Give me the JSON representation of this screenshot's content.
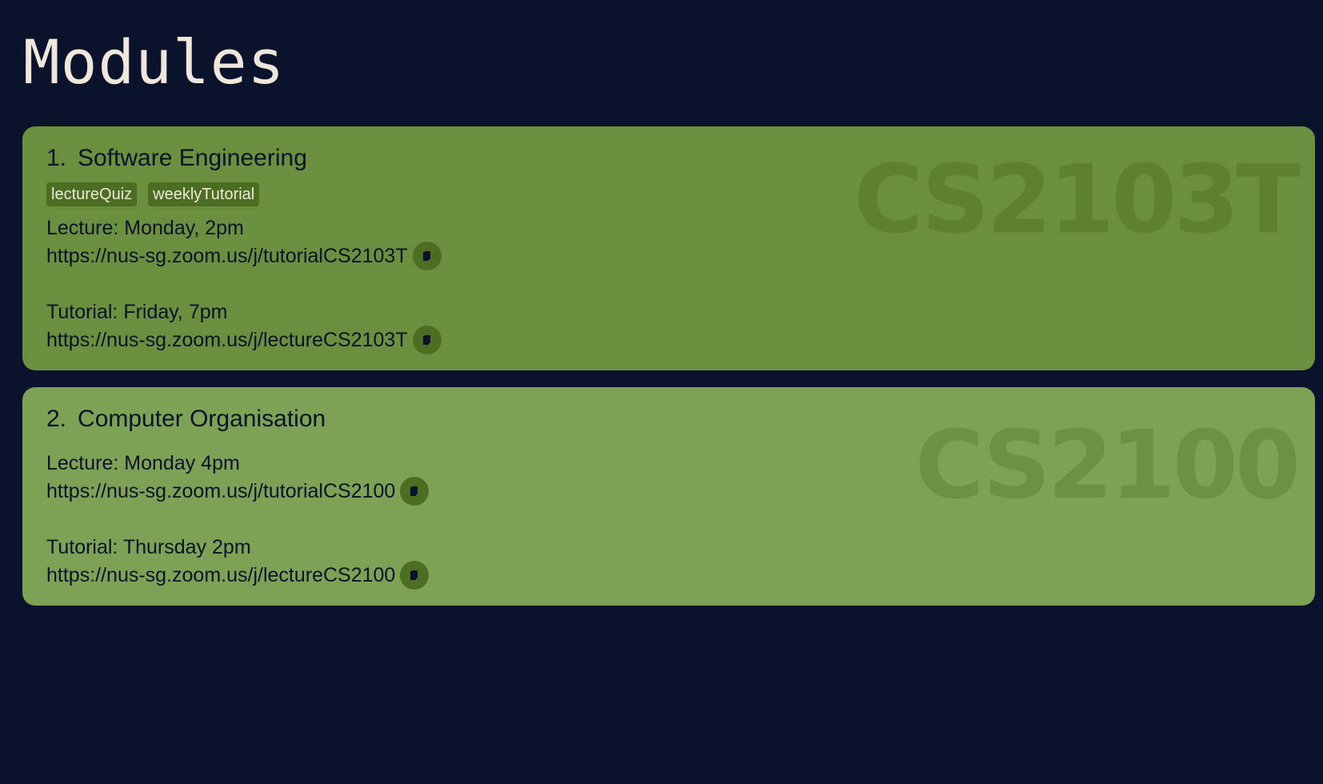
{
  "page": {
    "title": "Modules"
  },
  "modules": [
    {
      "index": "1.",
      "name": "Software Engineering",
      "code": "CS2103T",
      "tags": [
        "lectureQuiz",
        "weeklyTutorial"
      ],
      "lecture_label": "Lecture: Monday, 2pm",
      "lecture_link": "https://nus-sg.zoom.us/j/tutorialCS2103T",
      "tutorial_label": "Tutorial: Friday, 7pm",
      "tutorial_link": "https://nus-sg.zoom.us/j/lectureCS2103T",
      "color": "#6a8f3f"
    },
    {
      "index": "2.",
      "name": "Computer Organisation",
      "code": "CS2100",
      "tags": [],
      "lecture_label": "Lecture: Monday 4pm",
      "lecture_link": "https://nus-sg.zoom.us/j/tutorialCS2100",
      "tutorial_label": "Tutorial: Thursday 2pm",
      "tutorial_link": "https://nus-sg.zoom.us/j/lectureCS2100",
      "color": "#7da255"
    }
  ],
  "icons": {
    "copy": "copy-icon"
  },
  "colors": {
    "background": "#0b122b",
    "title_text": "#efe6dc",
    "tag_bg": "#4c6e22"
  }
}
